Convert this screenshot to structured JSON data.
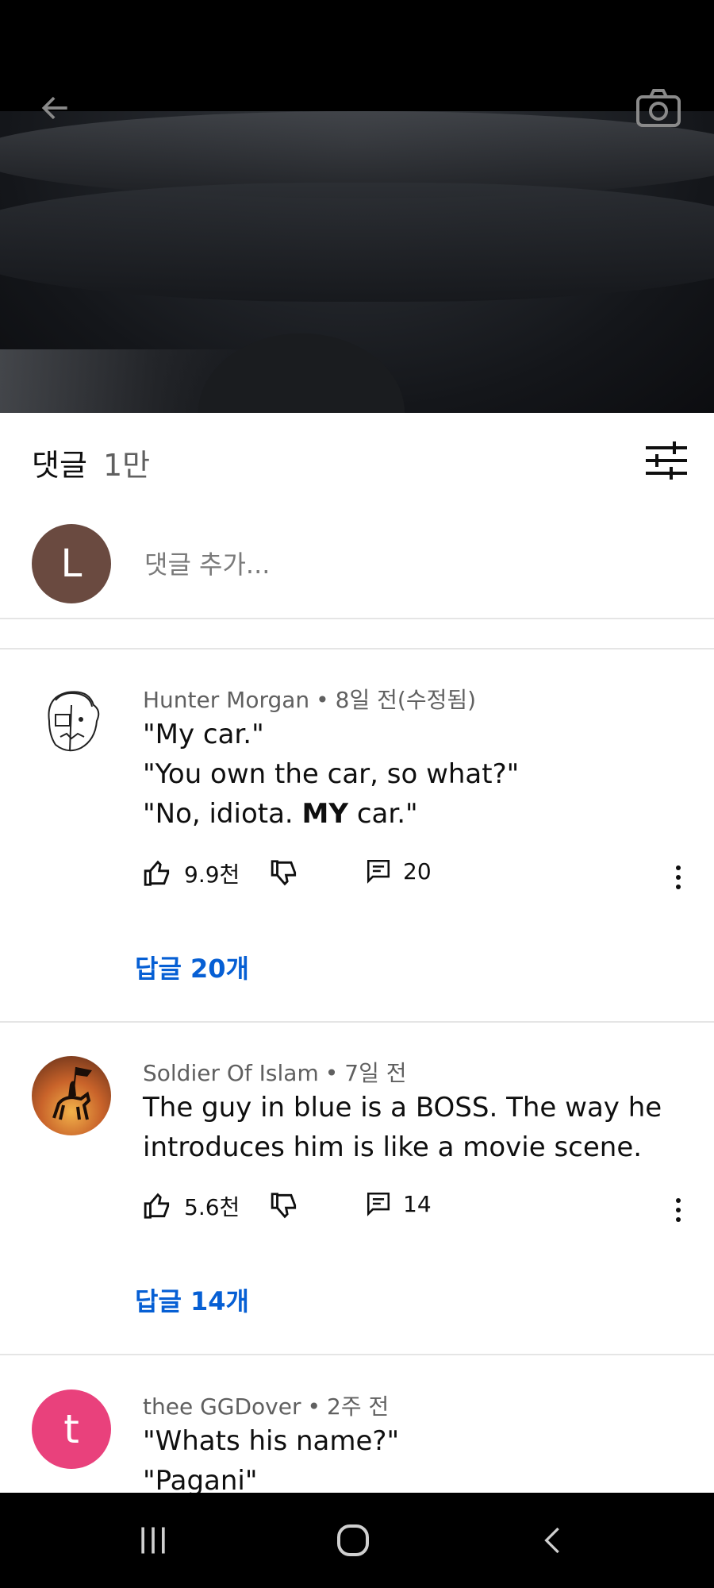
{
  "comments_panel": {
    "title": "댓글",
    "count": "1만",
    "add_comment_placeholder": "댓글 추가...",
    "current_user_initial": "L",
    "current_user_avatar_color": "#6a4a40"
  },
  "comments": [
    {
      "author": "Hunter Morgan",
      "time": "8일 전(수정됨)",
      "lines": [
        "\"My car.\"",
        "\"You own the car, so what?\""
      ],
      "last_line_pre": "\"No, idiota. ",
      "last_line_bold": "MY",
      "last_line_post": " car.\"",
      "likes": "9.9천",
      "reply_count": "20",
      "replies_link": "답글 20개"
    },
    {
      "author": "Soldier Of Islam",
      "time": "7일 전",
      "lines": [
        "The guy in blue is a BOSS. The way he",
        "introduces him is like a movie scene."
      ],
      "likes": "5.6천",
      "reply_count": "14",
      "replies_link": "답글 14개"
    },
    {
      "author": "thee GGDover",
      "time": "2주 전",
      "avatar_initial": "t",
      "avatar_color": "#e9417c",
      "lines": [
        "\"Whats his name?\"",
        "\"Pagani\""
      ]
    }
  ],
  "icons": {
    "back": "arrow-left-icon",
    "camera": "camera-icon",
    "filter": "sliders-icon",
    "like": "thumbs-up-icon",
    "dislike": "thumbs-down-icon",
    "reply": "comment-icon",
    "more": "more-vertical-icon",
    "nav_recents": "recent-apps-icon",
    "nav_home": "home-icon",
    "nav_back": "chevron-left-icon"
  },
  "colors": {
    "link_blue": "#065fd4",
    "meta_gray": "#606060"
  }
}
